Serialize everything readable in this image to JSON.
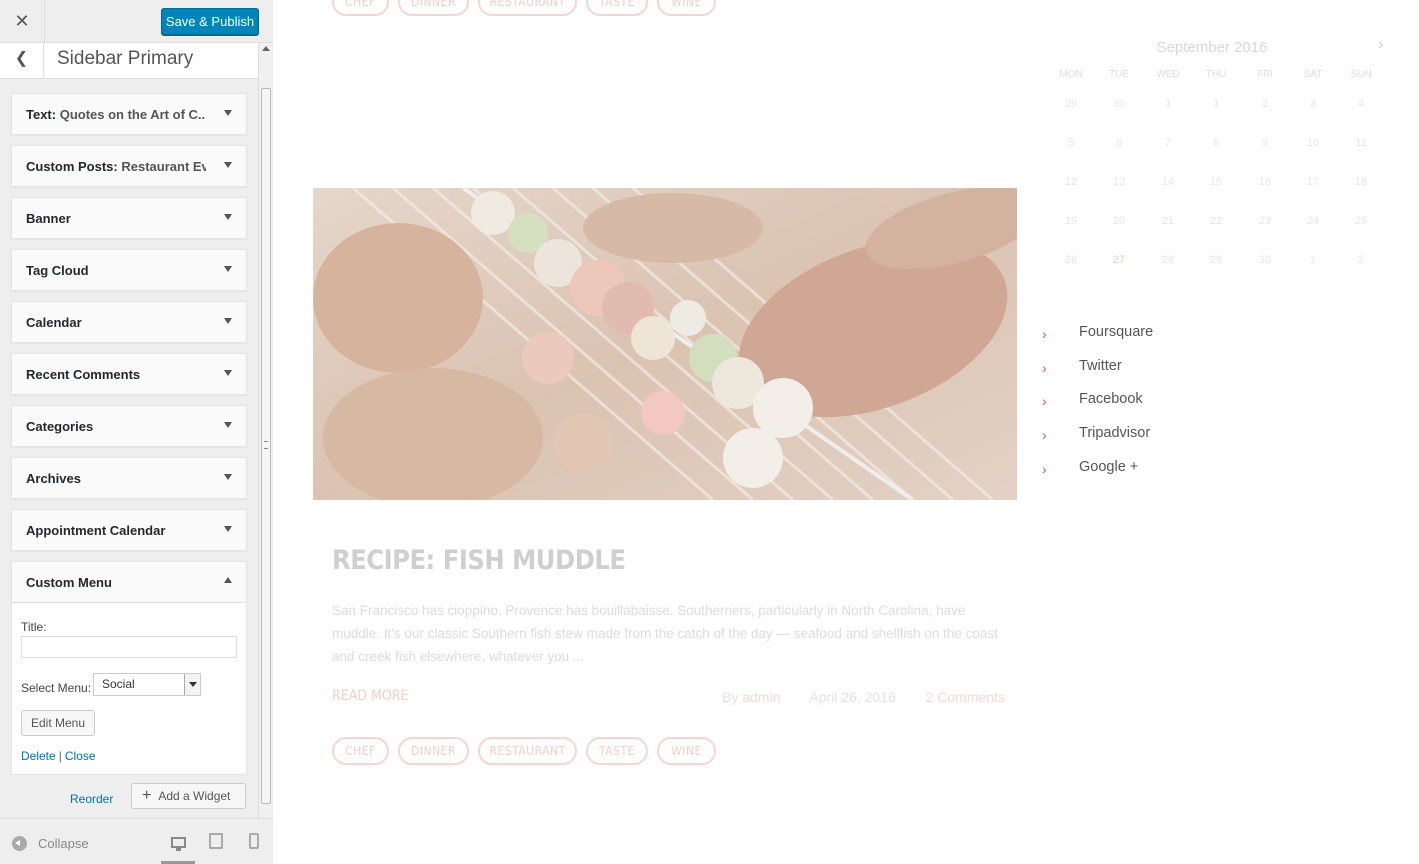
{
  "customizer": {
    "close_icon": "close-icon",
    "save_label": "Save & Publish",
    "section_title": "Sidebar Primary",
    "widgets": [
      {
        "type": "Text",
        "title": "Quotes on the Art of C..."
      },
      {
        "type": "Custom Posts",
        "title": "Restaurant Ev..."
      },
      {
        "type": "Banner",
        "title": ""
      },
      {
        "type": "Tag Cloud",
        "title": ""
      },
      {
        "type": "Calendar",
        "title": ""
      },
      {
        "type": "Recent Comments",
        "title": ""
      },
      {
        "type": "Categories",
        "title": ""
      },
      {
        "type": "Archives",
        "title": ""
      },
      {
        "type": "Appointment Calendar",
        "title": ""
      },
      {
        "type": "Custom Menu",
        "title": "",
        "expanded": true
      }
    ],
    "custom_menu": {
      "title_label": "Title:",
      "title_value": "",
      "select_label": "Select Menu:",
      "select_value": "Social",
      "edit_button": "Edit Menu",
      "delete_link": "Delete",
      "separator": "|",
      "close_link": "Close"
    },
    "reorder_link": "Reorder",
    "add_widget_label": "Add a Widget",
    "collapse_label": "Collapse"
  },
  "preview": {
    "top_tags": [
      "CHEF",
      "DINNER",
      "RESTAURANT",
      "TASTE",
      "WINE"
    ],
    "post": {
      "title": "RECIPE: FISH MUDDLE",
      "excerpt": "San Francisco has cioppino. Provence has bouillabaisse. Southerners, particularly in North Carolina, have muddle. It's our classic Southern fish stew made from the catch of the day — seafood and shellfish on the coast and creek fish elsewhere, whatever you ...",
      "read_more": "READ MORE",
      "author_prefix": "By",
      "author": "admin",
      "date": "April 26, 2016",
      "comments": "2 Comments",
      "tags": [
        "CHEF",
        "DINNER",
        "RESTAURANT",
        "TASTE",
        "WINE"
      ]
    },
    "calendar": {
      "month": "September 2016",
      "days_of_week": [
        "MON",
        "TUE",
        "WED",
        "THU",
        "FRI",
        "SAT",
        "SUN"
      ],
      "weeks": [
        [
          "29",
          "30",
          "1",
          "1",
          "2",
          "3",
          "4"
        ],
        [
          "5",
          "6",
          "7",
          "8",
          "9",
          "10",
          "11"
        ],
        [
          "12",
          "13",
          "14",
          "15",
          "16",
          "17",
          "18"
        ],
        [
          "19",
          "20",
          "21",
          "22",
          "23",
          "24",
          "25"
        ],
        [
          "26",
          "27",
          "28",
          "29",
          "30",
          "1",
          "2"
        ]
      ],
      "today": "27"
    },
    "social_links": [
      "Foursquare",
      "Twitter",
      "Facebook",
      "Tripadvisor",
      "Google +"
    ],
    "accent_color": "#d9533f"
  }
}
